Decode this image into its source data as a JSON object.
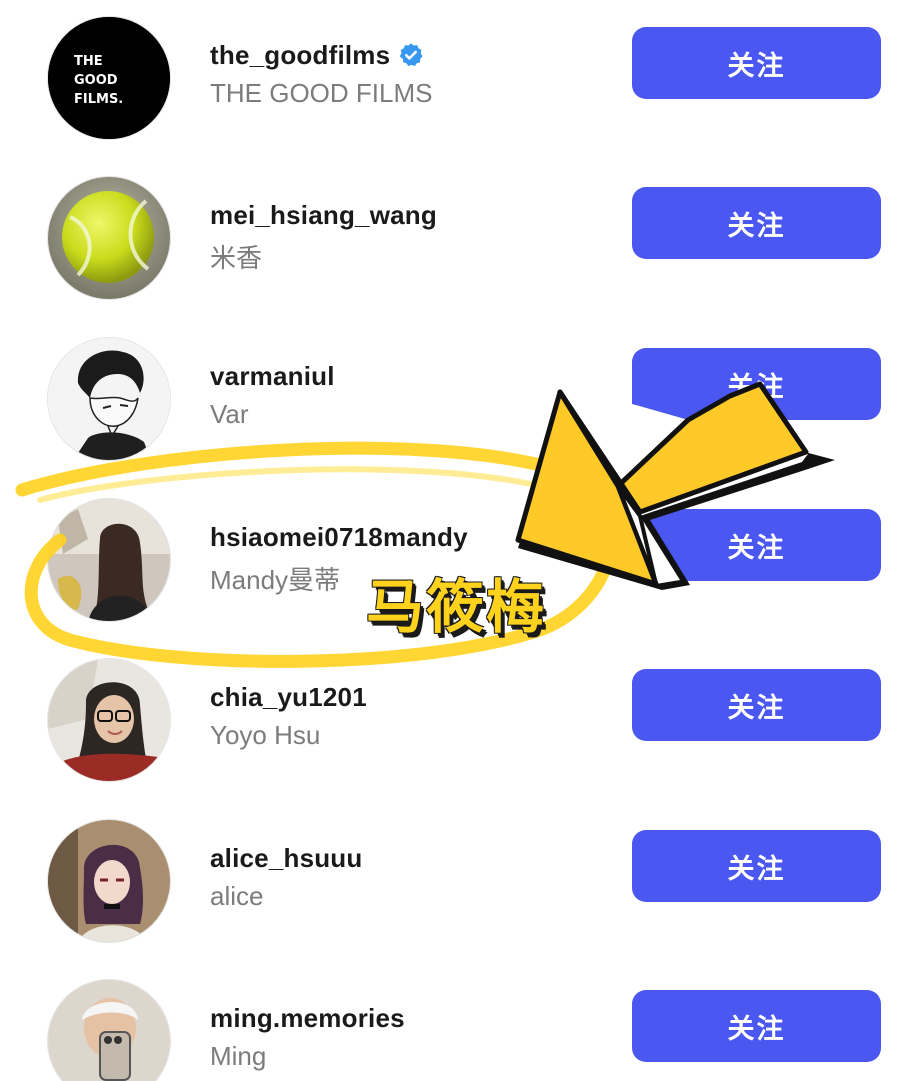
{
  "users": [
    {
      "username": "the_goodfilms",
      "fullname": "THE GOOD FILMS",
      "verified": true,
      "button": "关注",
      "avatar_text": [
        "THE",
        "GOOD",
        "FILMS."
      ]
    },
    {
      "username": "mei_hsiang_wang",
      "fullname": "米香",
      "button": "关注"
    },
    {
      "username": "varmaniul",
      "fullname": "Var",
      "button": "关注"
    },
    {
      "username": "hsiaomei0718mandy",
      "fullname": "Mandy曼蒂",
      "button": "关注"
    },
    {
      "username": "chia_yu1201",
      "fullname": "Yoyo Hsu",
      "button": "关注"
    },
    {
      "username": "alice_hsuuu",
      "fullname": "alice",
      "button": "关注"
    },
    {
      "username": "ming.memories",
      "fullname": "Ming",
      "button": "关注"
    }
  ],
  "annotation": {
    "text": "马筱梅",
    "highlight_color": "#ffd21e",
    "arrow_color": "#ffc928"
  },
  "colors": {
    "accent": "#4a57f0",
    "verified": "#3897f0"
  }
}
